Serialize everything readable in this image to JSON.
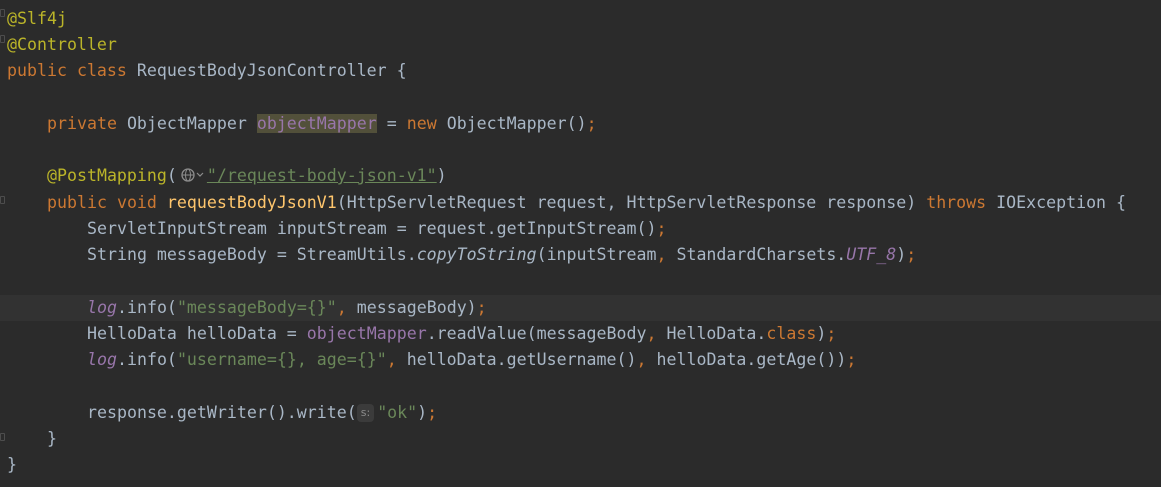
{
  "editor": {
    "lines": {
      "l1": {
        "annotation": "@Slf4j"
      },
      "l2": {
        "annotation": "@Controller"
      },
      "l3": {
        "kw_public": "public",
        "kw_class": "class",
        "name": "RequestBodyJsonController",
        "brace": "{"
      },
      "l5": {
        "kw_private": "private",
        "type": "ObjectMapper",
        "field": "objectMapper",
        "eq": "=",
        "kw_new": "new",
        "ctor": "ObjectMapper()",
        "semi": ";"
      },
      "l7": {
        "annotation": "@PostMapping",
        "paren_open": "(",
        "path": "\"/request-body-json-v1\"",
        "paren_close": ")"
      },
      "l8": {
        "kw_public": "public",
        "kw_void": "void",
        "method": "requestBodyJsonV1",
        "params": "(HttpServletRequest request, HttpServletResponse response)",
        "kw_throws": "throws",
        "exc": "IOException {"
      },
      "l9": {
        "code": "ServletInputStream inputStream = request.getInputStream()",
        "semi": ";"
      },
      "l10": {
        "pre": "String messageBody = StreamUtils.",
        "static_method": "copyToString",
        "mid": "(inputStream",
        "comma": ",",
        "mid2": " StandardCharsets.",
        "const": "UTF_8",
        "end": ")",
        "semi": ";"
      },
      "l12": {
        "log": "log",
        "call": ".info(",
        "str": "\"messageBody={}\"",
        "comma": ",",
        "rest": " messageBody)",
        "semi": ";"
      },
      "l13": {
        "pre": "HelloData helloData = ",
        "field": "objectMapper",
        "call": ".readValue(messageBody",
        "comma": ",",
        "rest": " HelloData.",
        "kw_class": "class",
        "end": ")",
        "semi": ";"
      },
      "l14": {
        "log": "log",
        "call": ".info(",
        "str": "\"username={}, age={}\"",
        "comma1": ",",
        "mid": " helloData.getUsername()",
        "comma2": ",",
        "rest": " helloData.getAge())",
        "semi": ";"
      },
      "l16": {
        "pre": "response.getWriter().write(",
        "hint": "s:",
        "str": "\"ok\"",
        "end": ")",
        "semi": ";"
      },
      "l17": {
        "brace": "}"
      },
      "l18": {
        "brace": "}"
      }
    }
  },
  "colors": {
    "background": "#2b2b2b",
    "current_line": "#323232",
    "default_text": "#a9b7c6",
    "keyword": "#cc7832",
    "annotation": "#bbb529",
    "string": "#6a8759",
    "field": "#9876aa",
    "method_decl": "#ffc66d"
  },
  "icons": {
    "url_hint": "globe-icon",
    "fold_markers": "fold-marker-icon"
  }
}
